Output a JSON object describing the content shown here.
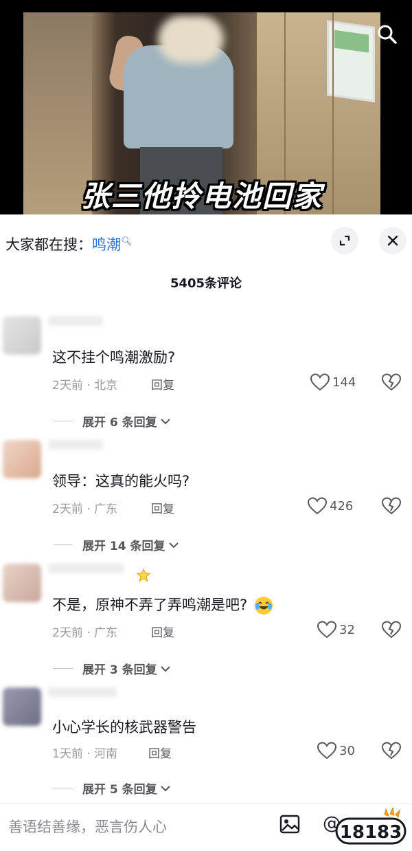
{
  "video": {
    "caption": "张三他拎电池回家",
    "search_icon": "search-icon"
  },
  "suggest": {
    "prefix": "大家都在搜：",
    "term": "鸣潮",
    "expand_icon": "expand-icon",
    "close_icon": "close-icon"
  },
  "comments_header": {
    "count_label": "5405条评论"
  },
  "comments": [
    {
      "text": "这不挂个鸣潮激励?",
      "meta": "2天前 · 北京",
      "reply": "回复",
      "likes": "144",
      "expand": "展开 6 条回复",
      "avatar_color": "#d8d8d8"
    },
    {
      "text": "领导：这真的能火吗?",
      "meta": "2天前 · 广东",
      "reply": "回复",
      "likes": "426",
      "expand": "展开 14 条回复",
      "avatar_color": "#e8c3b0"
    },
    {
      "text": "不是，原神不弄了弄鸣潮是吧?",
      "meta": "2天前 · 广东",
      "reply": "回复",
      "likes": "32",
      "expand": "展开 3 条回复",
      "avatar_color": "#d9c0b8"
    },
    {
      "text": "小心学长的核武器警告",
      "meta": "1天前 · 河南",
      "reply": "回复",
      "likes": "30",
      "expand": "展开 5 条回复",
      "avatar_color": "#8a8a9e"
    }
  ],
  "input_bar": {
    "placeholder": "善语结善缘，恶言伤人心",
    "at_symbol": "@",
    "watermark": "18183"
  },
  "colors": {
    "link": "#2a6fd6",
    "text": "#161823",
    "muted": "#9a9aa0"
  }
}
